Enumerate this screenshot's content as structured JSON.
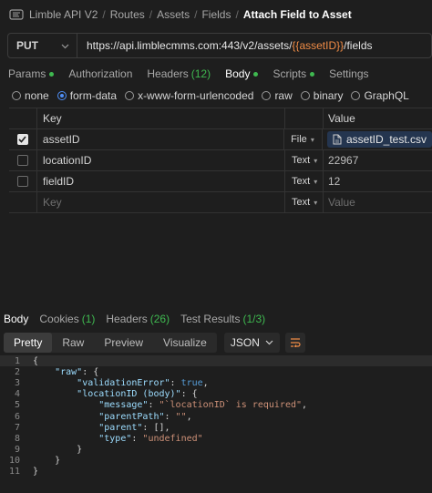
{
  "breadcrumb": {
    "items": [
      "Limble API V2",
      "Routes",
      "Assets",
      "Fields",
      "Attach Field to Asset"
    ]
  },
  "request": {
    "method": "PUT",
    "url_prefix": "https://api.limblecmms.com:443/v2/assets/",
    "url_var": "{{assetID}}",
    "url_suffix": "/fields"
  },
  "request_tabs": {
    "params": "Params",
    "authorization": "Authorization",
    "headers": "Headers",
    "headers_count": "(12)",
    "body": "Body",
    "scripts": "Scripts",
    "settings": "Settings"
  },
  "body_types": {
    "none": "none",
    "form_data": "form-data",
    "urlencoded": "x-www-form-urlencoded",
    "raw": "raw",
    "binary": "binary",
    "graphql": "GraphQL",
    "selected": "form-data"
  },
  "form_table": {
    "headers": {
      "key": "Key",
      "value": "Value"
    },
    "rows": [
      {
        "checked": true,
        "key": "assetID",
        "type": "File",
        "value": "assetID_test.csv"
      },
      {
        "checked": false,
        "key": "locationID",
        "type": "Text",
        "value": "22967"
      },
      {
        "checked": false,
        "key": "fieldID",
        "type": "Text",
        "value": "12"
      }
    ],
    "empty_row": {
      "key_placeholder": "Key",
      "type": "Text",
      "value_placeholder": "Value"
    }
  },
  "response_tabs": {
    "body": "Body",
    "cookies": "Cookies",
    "cookies_count": "(1)",
    "headers": "Headers",
    "headers_count": "(26)",
    "test_results": "Test Results",
    "test_results_count": "(1/3)"
  },
  "response_toolbar": {
    "pretty": "Pretty",
    "raw": "Raw",
    "preview": "Preview",
    "visualize": "Visualize",
    "format": "JSON"
  },
  "response_body": {
    "line_numbers": [
      "1",
      "2",
      "3",
      "4",
      "5",
      "6",
      "7",
      "8",
      "9",
      "10",
      "11"
    ],
    "l1": "{",
    "l2_key": "\"raw\"",
    "l2_rest": ": {",
    "l3_key": "\"validationError\"",
    "l3_sep": ": ",
    "l3_val": "true",
    "l3_end": ",",
    "l4_key": "\"locationID (body)\"",
    "l4_rest": ": {",
    "l5_key": "\"message\"",
    "l5_sep": ": ",
    "l5_val": "\"`locationID` is required\"",
    "l5_end": ",",
    "l6_key": "\"parentPath\"",
    "l6_sep": ": ",
    "l6_val": "\"\"",
    "l6_end": ",",
    "l7_key": "\"parent\"",
    "l7_rest": ": [],",
    "l8_key": "\"type\"",
    "l8_sep": ": ",
    "l8_val": "\"undefined\"",
    "l9": "}",
    "l10": "}",
    "l11": "}"
  },
  "colors": {
    "background": "#1e1e1e",
    "accent_green": "#3fb950",
    "variable_orange": "#f08c46",
    "radio_blue": "#4f8ff7",
    "string_orange": "#ce9178",
    "key_blue": "#9cdcfe",
    "keyword_blue": "#569cd6"
  },
  "icons": [
    "api-collection-icon",
    "chevron-down-icon",
    "checkbox-checked-icon",
    "file-icon",
    "wrap-lines-icon"
  ]
}
